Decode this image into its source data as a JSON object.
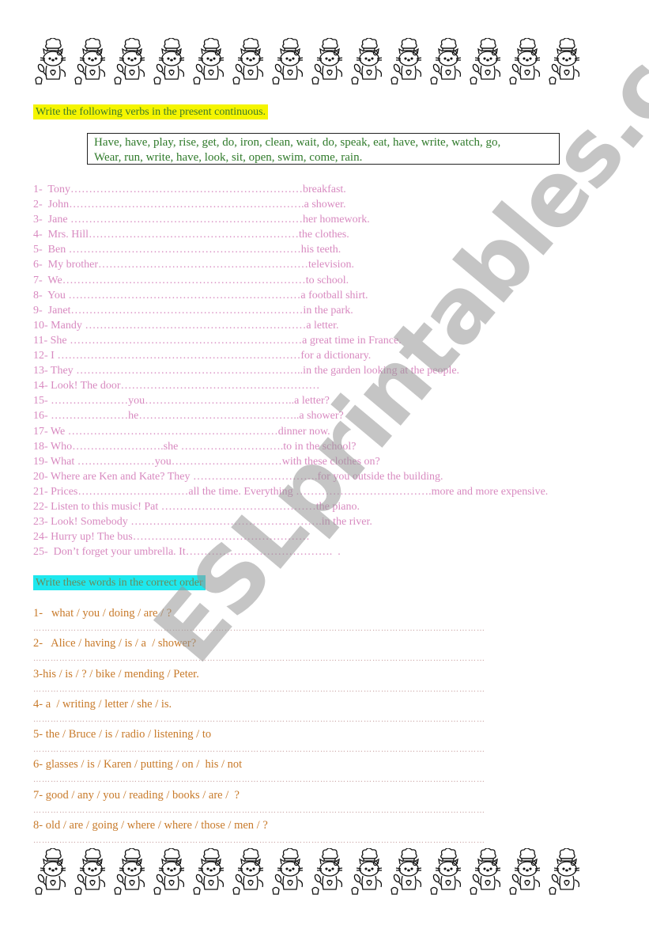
{
  "decoration": {
    "icon": "hello-kitty-chef-icon",
    "count_per_row": 14
  },
  "exercise1": {
    "instruction": "Write the following verbs in the present continuous.",
    "highlight_color": "#f5f500",
    "verb_list": [
      "Have, have, play, rise, get, do, iron, clean, wait, do, speak, eat, have, write, watch, go,",
      "Wear, run, write, have, look, sit, open, swim, come, rain."
    ],
    "lines": [
      "1-  Tony………………………………………………………breakfast.",
      "2-  John……………………………………………………….a shower.",
      "3-  Jane ………………………………………………………her homework.",
      "4-  Mrs. Hill…………………………………………………the clothes.",
      "5-  Ben ………………………………………………………his teeth.",
      "6-  My brother…………………………………………………television.",
      "7-  We…………………………………………………………to school.",
      "8-  You ………………………………………………………a football shirt.",
      "9-  Janet………………………………………………………in the park.",
      "10- Mandy ……………………………………………………a letter.",
      "11- She ………………………………………………………a great time in France.",
      "12- I …………………………………………………………for a dictionary.",
      "13- They ……………………………………………………..in the garden looking at the people.",
      "14- Look! The door………………………………………………",
      "15- …………………you…………………………………..a letter?",
      "16- …………………he……………………………………..a shower?",
      "17- We …………………………………………………dinner now.",
      "18- Who…………………….she ……………………….to in the school?",
      "19- What …………………you…………………………with these clothes on?",
      "20- Where are Ken and Kate? They …………………………….for you outside the building.",
      "21- Prices…………………………all the time. Everything ……………………………….more and more expensive.",
      "22- Listen to this music! Pat ……………………………………the piano.",
      "23- Look! Somebody …………………………………………….in the river.",
      "24- Hurry up! The bus…………………………………………",
      "25-  Don’t forget your umbrella. It………………………………….  ."
    ]
  },
  "exercise2": {
    "instruction": "Write these words in the correct order",
    "highlight_color": "#1ee8ee",
    "items": [
      "1-   what / you / doing / are / ?",
      "2-   Alice / having / is / a  / shower?",
      "3-his / is / ? / bike / mending / Peter.",
      "4- a  / writing / letter / she / is.",
      "5- the / Bruce / is / radio / listening / to",
      "6- glasses / is / Karen / putting / on /  his / not",
      "7- good / any / you / reading / books / are /  ?",
      "8- old / are / going / where / where / those / men / ?"
    ],
    "answer_line": "……………………………………………………………………………………………………………………………………………………"
  },
  "watermark": "ESLprintables.com"
}
